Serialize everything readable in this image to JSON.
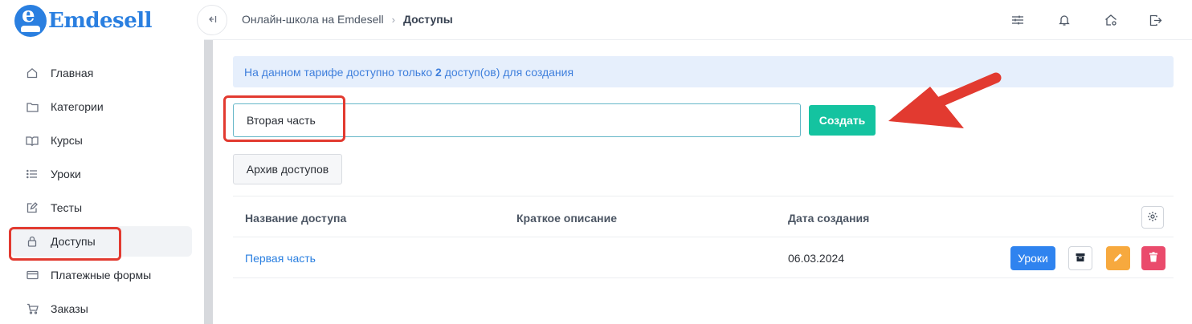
{
  "logo": {
    "text": "Emdesell"
  },
  "sidebar": {
    "items": [
      {
        "label": "Главная",
        "icon": "home-icon"
      },
      {
        "label": "Категории",
        "icon": "folder-icon"
      },
      {
        "label": "Курсы",
        "icon": "book-icon"
      },
      {
        "label": "Уроки",
        "icon": "list-icon"
      },
      {
        "label": "Тесты",
        "icon": "edit-icon"
      },
      {
        "label": "Доступы",
        "icon": "lock-icon",
        "active": true
      },
      {
        "label": "Платежные формы",
        "icon": "credit-card-icon"
      },
      {
        "label": "Заказы",
        "icon": "cart-icon"
      }
    ]
  },
  "header": {
    "breadcrumb": {
      "root": "Онлайн-школа на Emdesell",
      "current": "Доступы"
    },
    "icons": [
      "settings-sliders-icon",
      "bell-icon",
      "home-settings-icon",
      "logout-icon"
    ]
  },
  "alert": {
    "prefix": "На данном тарифе доступно только ",
    "count": "2",
    "suffix": " доступ(ов) для создания"
  },
  "form": {
    "input_value": "Вторая часть",
    "create_label": "Создать",
    "archive_label": "Архив доступов"
  },
  "table": {
    "headers": [
      "Название доступа",
      "Краткое описание",
      "Дата создания"
    ],
    "rows": [
      {
        "name": "Первая часть",
        "description": "",
        "date": "06.03.2024",
        "lessons_label": "Уроки"
      }
    ]
  },
  "colors": {
    "brand": "#2a7fe0",
    "create": "#14c3a0",
    "edit": "#f7a93e",
    "delete": "#ea4b6c",
    "annotation": "#e23a30"
  }
}
